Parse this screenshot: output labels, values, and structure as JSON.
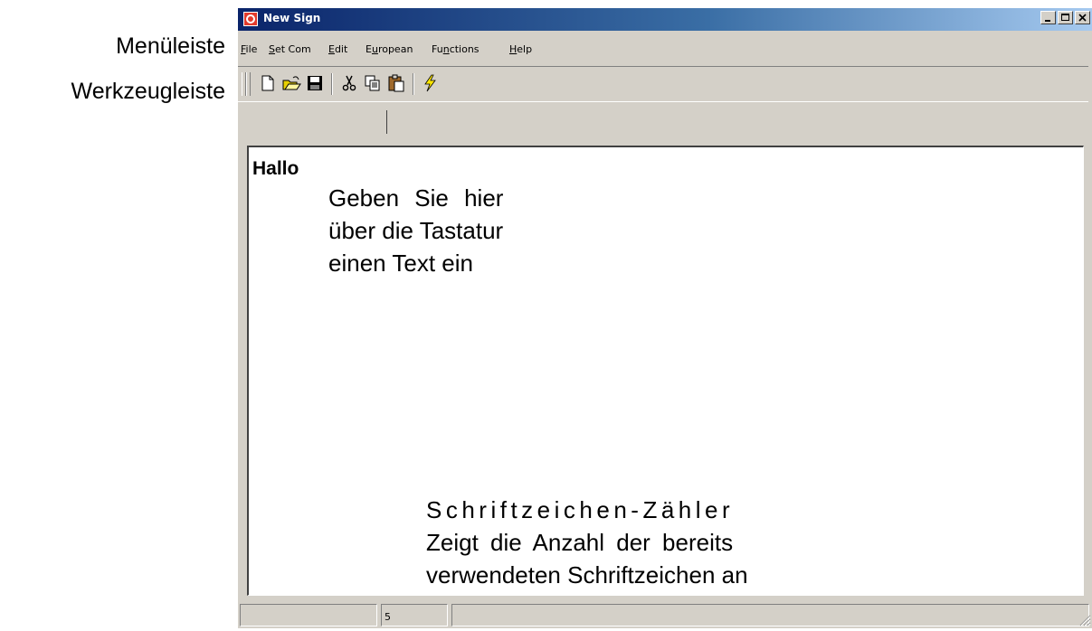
{
  "annotations": {
    "menubar_label": "Menüleiste",
    "toolbar_label": "Werkzeugleiste"
  },
  "window": {
    "title": "New Sign",
    "controls": {
      "minimize": "minimize-icon",
      "maximize": "maximize-icon",
      "close": "close-icon"
    }
  },
  "menubar": {
    "items": [
      {
        "underline": "F",
        "rest": "ile"
      },
      {
        "underline": "S",
        "rest": "et Com"
      },
      {
        "underline": "E",
        "rest": "dit"
      },
      {
        "pre": "E",
        "underline": "u",
        "rest": "ropean"
      },
      {
        "pre": "Fu",
        "underline": "n",
        "rest": "ctions"
      },
      {
        "underline": "H",
        "rest": "elp"
      }
    ]
  },
  "toolbar": {
    "buttons": [
      "new-file-icon",
      "open-folder-icon",
      "save-icon",
      "cut-icon",
      "copy-icon",
      "paste-icon",
      "lightning-icon"
    ]
  },
  "editor": {
    "text": "Hallo",
    "input_hint": {
      "line1": "Geben Sie hier",
      "line2": "über die Tastatur",
      "line3": "einen Text ein"
    },
    "counter_hint": {
      "title": "Schriftzeichen-Zähler",
      "line1": "Zeigt die Anzahl der bereits",
      "line2": "verwendeten Schriftzeichen an"
    }
  },
  "statusbar": {
    "panel1": "",
    "char_count": "5",
    "panel3": ""
  },
  "colors": {
    "title_gradient_start": "#0a246a",
    "title_gradient_end": "#a6caf0",
    "window_face": "#d4d0c8"
  }
}
